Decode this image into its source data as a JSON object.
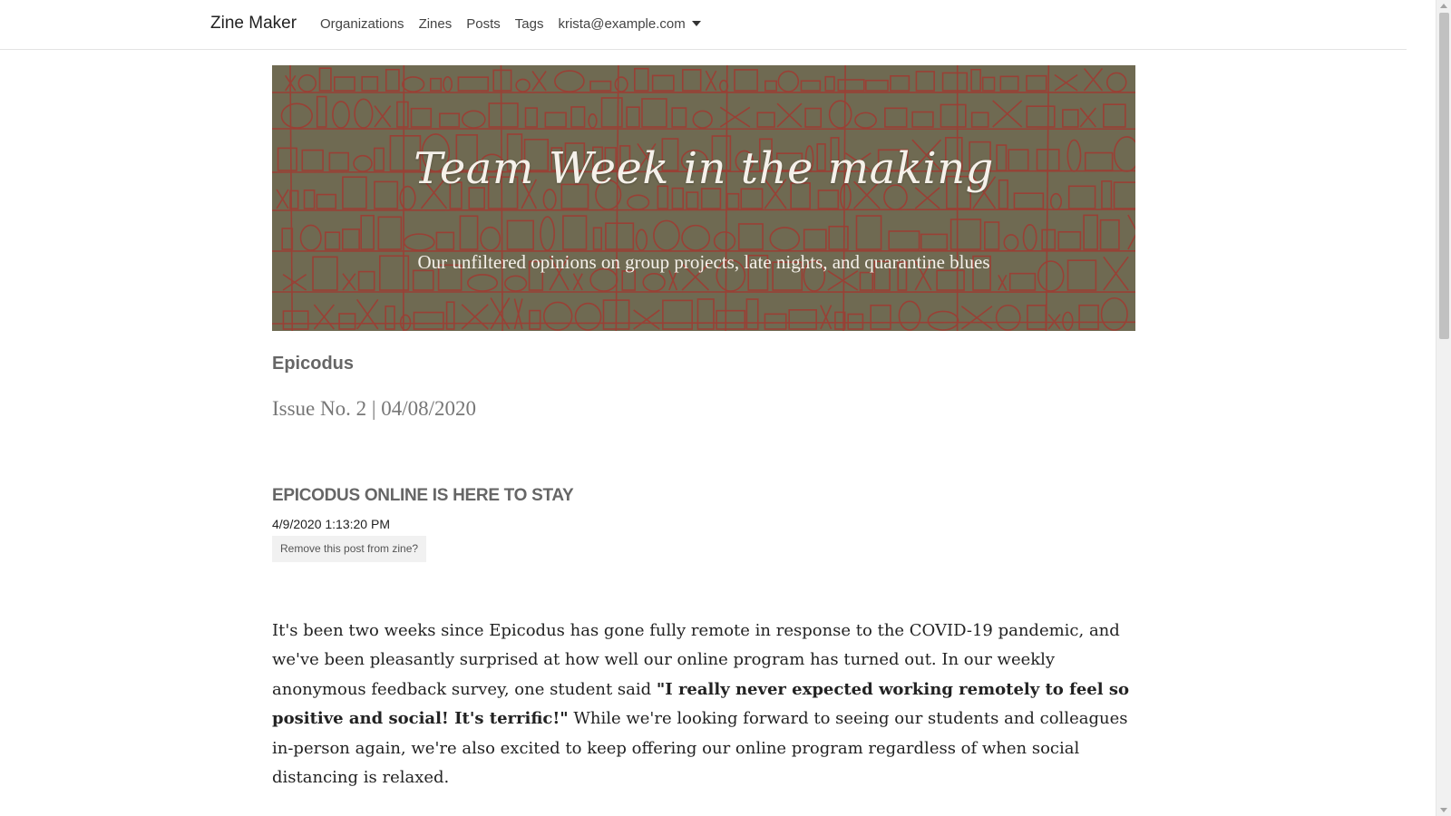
{
  "nav": {
    "brand": "Zine Maker",
    "links": [
      "Organizations",
      "Zines",
      "Posts",
      "Tags"
    ],
    "user": "krista@example.com"
  },
  "hero": {
    "title": "Team Week in the making",
    "subtitle": "Our unfiltered opinions on group projects, late nights, and quarantine blues"
  },
  "zine": {
    "organization": "Epicodus",
    "issue": "Issue No. 2 | 04/08/2020"
  },
  "post": {
    "title": "EPICODUS ONLINE IS HERE TO STAY",
    "date": "4/9/2020 1:13:20 PM",
    "remove_label": "Remove this post from zine?",
    "body_before": "It's been two weeks since Epicodus has gone fully remote in response to the COVID-19 pandemic, and we've been pleasantly surprised at how well our online program has turned out. In our weekly anonymous feedback survey, one student said ",
    "body_quote": "\"I really never expected working remotely to feel so positive and social! It's terrific!\"",
    "body_after": " While we're looking forward to seeing our students and colleagues in-person again, we're also excited to keep offering our online program regardless of when social distancing is relaxed."
  },
  "colors": {
    "hero_overlay": "#6f6a52",
    "hero_sketch": "#a8322c",
    "nav_border": "#e3e3e3"
  }
}
